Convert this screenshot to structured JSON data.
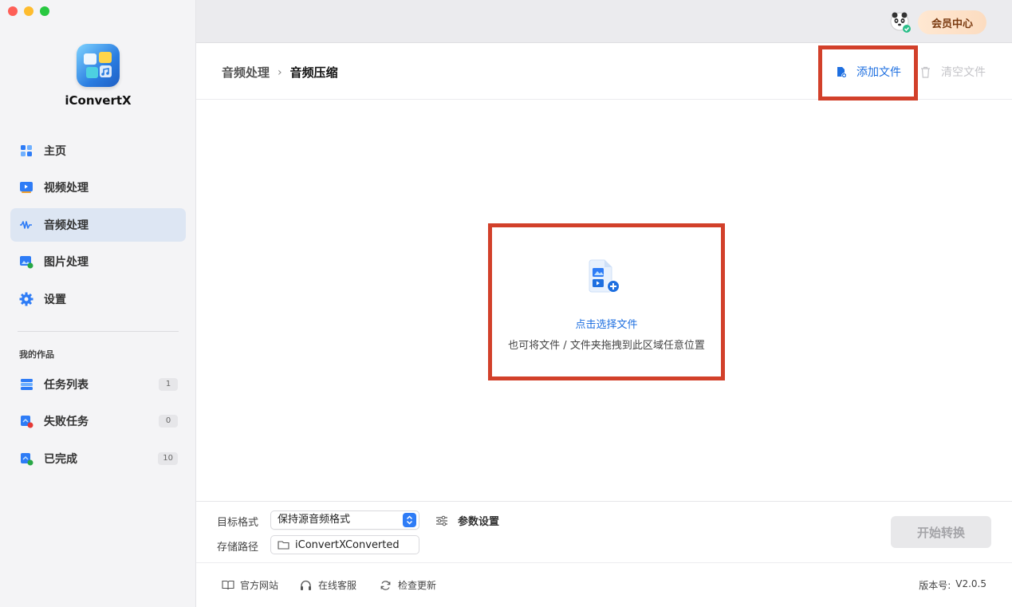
{
  "app": {
    "name": "iConvertX"
  },
  "sidebar": {
    "items": [
      {
        "label": "主页",
        "icon": "home-icon"
      },
      {
        "label": "视频处理",
        "icon": "video-icon"
      },
      {
        "label": "音频处理",
        "icon": "audio-wave-icon",
        "active": true
      },
      {
        "label": "图片处理",
        "icon": "image-icon"
      },
      {
        "label": "设置",
        "icon": "gear-icon"
      }
    ],
    "section_title": "我的作品",
    "works": [
      {
        "label": "任务列表",
        "count": "1",
        "icon": "task-list-icon"
      },
      {
        "label": "失败任务",
        "count": "0",
        "icon": "failed-task-icon"
      },
      {
        "label": "已完成",
        "count": "10",
        "icon": "completed-icon"
      }
    ]
  },
  "topbar": {
    "member_label": "会员中心"
  },
  "header": {
    "breadcrumb_parent": "音频处理",
    "breadcrumb_sep": "›",
    "breadcrumb_current": "音频压缩",
    "add_file_label": "添加文件",
    "clear_file_label": "清空文件"
  },
  "dropzone": {
    "title": "点击选择文件",
    "subtitle": "也可将文件 / 文件夹拖拽到此区域任意位置"
  },
  "bottom": {
    "format_label": "目标格式",
    "format_value": "保持源音频格式",
    "params_label": "参数设置",
    "path_label": "存储路径",
    "path_value": "iConvertXConverted",
    "start_label": "开始转换"
  },
  "footer": {
    "website": "官方网站",
    "support": "在线客服",
    "update": "检查更新",
    "version_label": "版本号:",
    "version_value": "V2.0.5"
  },
  "colors": {
    "accent": "#1e6fe0",
    "highlight": "#d2402a",
    "active_nav_bg": "#dde6f3"
  }
}
